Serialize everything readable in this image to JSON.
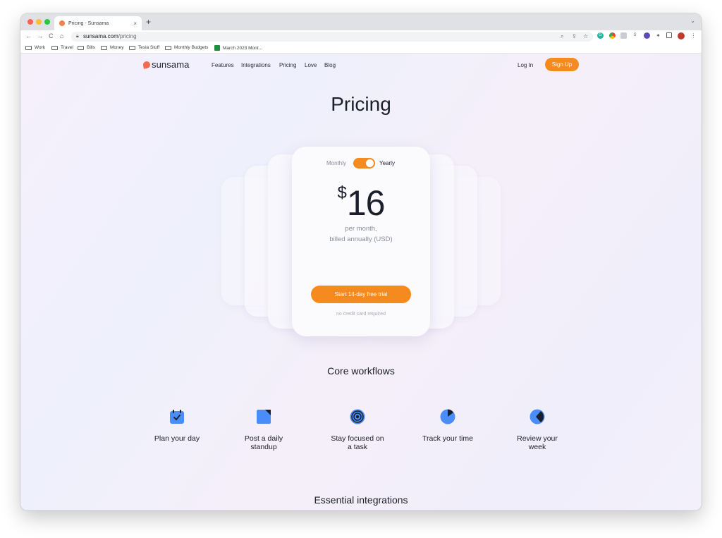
{
  "browser": {
    "tab_title": "Pricing - Sunsama",
    "tab_close": "×",
    "new_tab": "+",
    "tab_menu": "⌄",
    "back": "←",
    "forward": "→",
    "reload": "C",
    "home": "⌂",
    "url_host": "sunsama.com",
    "url_path": "/pricing",
    "bookmarks": [
      "Work",
      "Travel",
      "Bills",
      "Money",
      "Tesla Stuff",
      "Monthly Budgets",
      "March 2023 Mont..."
    ],
    "colors": {
      "close": "#fe5f57",
      "minimize": "#febc2e",
      "zoom": "#28c840"
    }
  },
  "nav": {
    "logo": "sunsama",
    "links": [
      "Features",
      "Integrations",
      "Pricing",
      "Love",
      "Blog"
    ],
    "login": "Log In",
    "signup": "Sign Up"
  },
  "pricing": {
    "title": "Pricing",
    "toggle_monthly": "Monthly",
    "toggle_yearly": "Yearly",
    "billing_selected": "Yearly",
    "currency": "$",
    "amount": "16",
    "note_line1": "per month,",
    "note_line2": "billed annually (USD)",
    "cta": "Start 14-day free trial",
    "no_cc": "no credit card required"
  },
  "core": {
    "title": "Core workflows",
    "items": [
      {
        "icon": "calendar-check-icon",
        "line1": "Plan your day",
        "line2": ""
      },
      {
        "icon": "folded-square-icon",
        "line1": "Post a daily",
        "line2": "standup"
      },
      {
        "icon": "target-icon",
        "line1": "Stay focused on",
        "line2": "a task"
      },
      {
        "icon": "pie-clock-icon",
        "line1": "Track your time",
        "line2": ""
      },
      {
        "icon": "half-moon-icon",
        "line1": "Review your",
        "line2": "week"
      }
    ]
  },
  "integrations": {
    "title": "Essential integrations"
  },
  "colors": {
    "accent": "#f58a1f",
    "icon_blue": "#4b8df8",
    "text_dark": "#1b1e2b"
  }
}
